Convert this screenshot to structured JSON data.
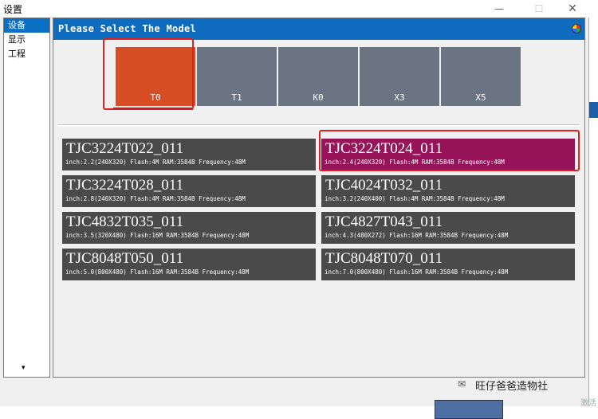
{
  "window": {
    "title": "设置",
    "min_label": "—",
    "max_label": "☐",
    "close_label": "✕"
  },
  "sidebar": {
    "items": [
      {
        "label": "设备"
      },
      {
        "label": "显示"
      },
      {
        "label": "工程"
      }
    ],
    "scroll_arrow": "▾"
  },
  "panel": {
    "title": "Please Select The Model"
  },
  "series": [
    {
      "label": "T0"
    },
    {
      "label": "T1"
    },
    {
      "label": "K0"
    },
    {
      "label": "X3"
    },
    {
      "label": "X5"
    }
  ],
  "selected_series": "T0",
  "models": [
    {
      "name": "TJC3224T022_011",
      "spec": "inch:2.2(240X320) Flash:4M RAM:3584B Frequency:48M"
    },
    {
      "name": "TJC3224T024_011",
      "spec": "inch:2.4(240X320) Flash:4M RAM:3584B Frequency:48M"
    },
    {
      "name": "TJC3224T028_011",
      "spec": "inch:2.8(240X320) Flash:4M RAM:3584B Frequency:48M"
    },
    {
      "name": "TJC4024T032_011",
      "spec": "inch:3.2(240X400) Flash:4M RAM:3584B Frequency:48M"
    },
    {
      "name": "TJC4832T035_011",
      "spec": "inch:3.5(320X480) Flash:16M RAM:3584B Frequency:48M"
    },
    {
      "name": "TJC4827T043_011",
      "spec": "inch:4.3(480X272) Flash:16M RAM:3584B Frequency:48M"
    },
    {
      "name": "TJC8048T050_011",
      "spec": "inch:5.0(800X480) Flash:16M RAM:3584B Frequency:48M"
    },
    {
      "name": "TJC8048T070_011",
      "spec": "inch:7.0(800X480) Flash:16M RAM:3584B Frequency:48M"
    }
  ],
  "selected_model": "TJC3224T024_011",
  "watermark": "旺仔爸爸造物社",
  "corner_text": "激活",
  "colors": {
    "accent": "#0f6bbd",
    "series_selected": "#d74e24",
    "model_selected": "#97145b",
    "tile": "#4a4a4a",
    "highlight": "#e02020"
  }
}
